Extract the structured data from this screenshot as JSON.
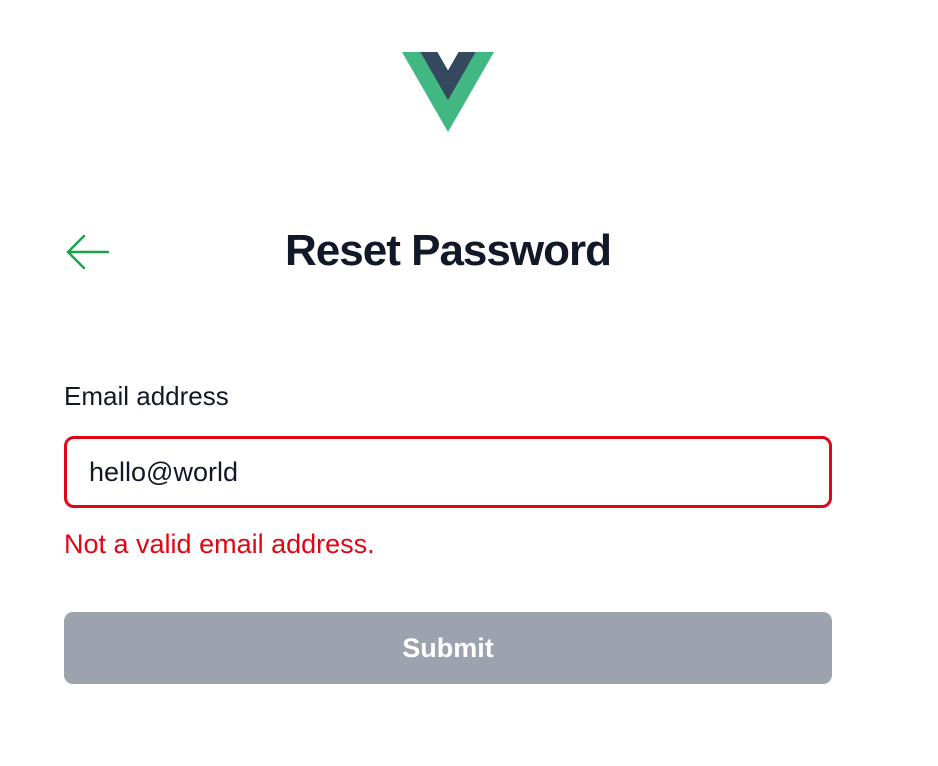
{
  "logo": {
    "icon": "vue-logo-icon",
    "colors": {
      "outer": "#41b883",
      "inner": "#35495e"
    }
  },
  "header": {
    "back_icon": "arrow-left-icon",
    "back_color": "#16a34a",
    "title": "Reset Password"
  },
  "form": {
    "email_label": "Email address",
    "email_value": "hello@world",
    "error_message": "Not a valid email address.",
    "error_color": "#e00613",
    "submit_label": "Submit",
    "submit_color": "#9ca3ae"
  }
}
